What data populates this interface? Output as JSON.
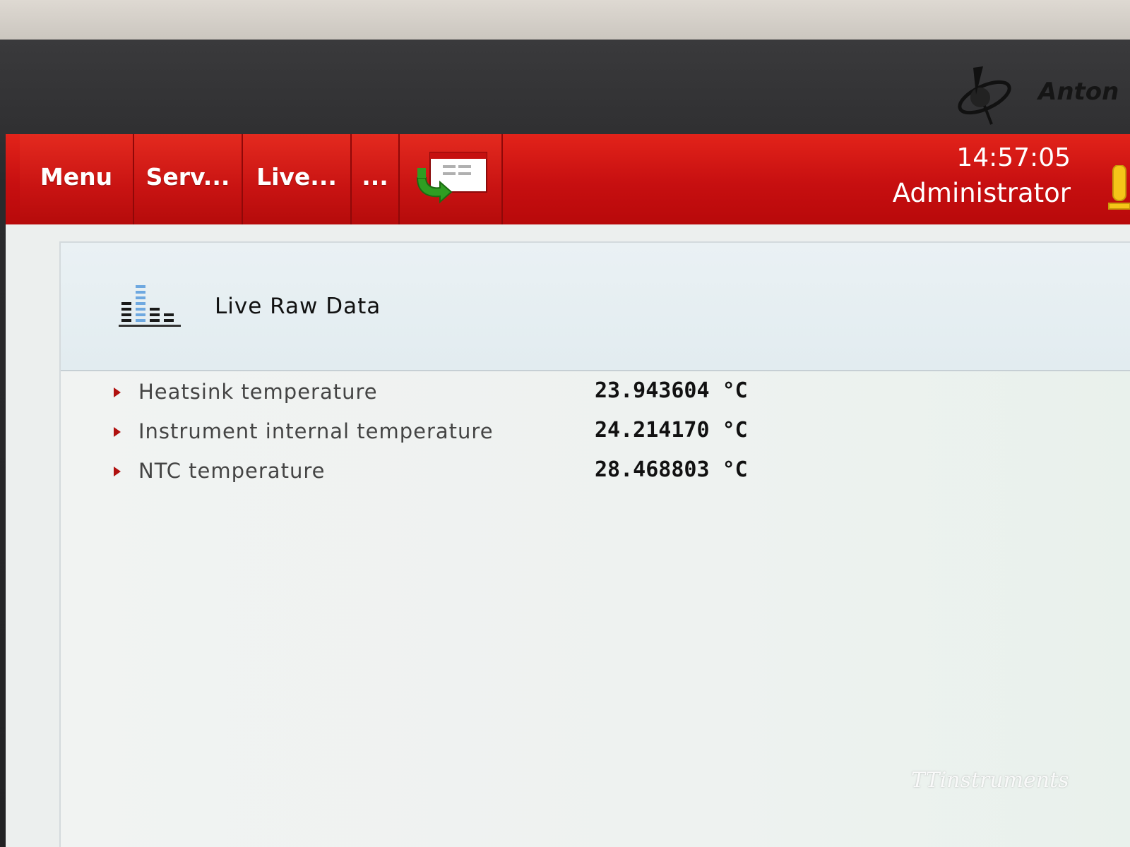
{
  "brand": {
    "name": "Anton"
  },
  "header": {
    "tabs": [
      {
        "label": "Menu"
      },
      {
        "label": "Serv..."
      },
      {
        "label": "Live..."
      },
      {
        "label": "..."
      }
    ],
    "icon_tab": {
      "icon": "system-window-arrow-icon"
    },
    "time": "14:57:05",
    "user": "Administrator",
    "user_icon": "user-key-icon",
    "colors": {
      "bar": "#d0100f",
      "text": "#ffffff"
    }
  },
  "page": {
    "title": "Live Raw Data",
    "icon": "bar-chart-icon"
  },
  "rows": [
    {
      "label": "Heatsink temperature",
      "value": "23.943604 °C"
    },
    {
      "label": "Instrument internal temperature",
      "value": "24.214170 °C"
    },
    {
      "label": "NTC temperature",
      "value": "28.468803 °C"
    }
  ],
  "watermark": "TTinstruments"
}
